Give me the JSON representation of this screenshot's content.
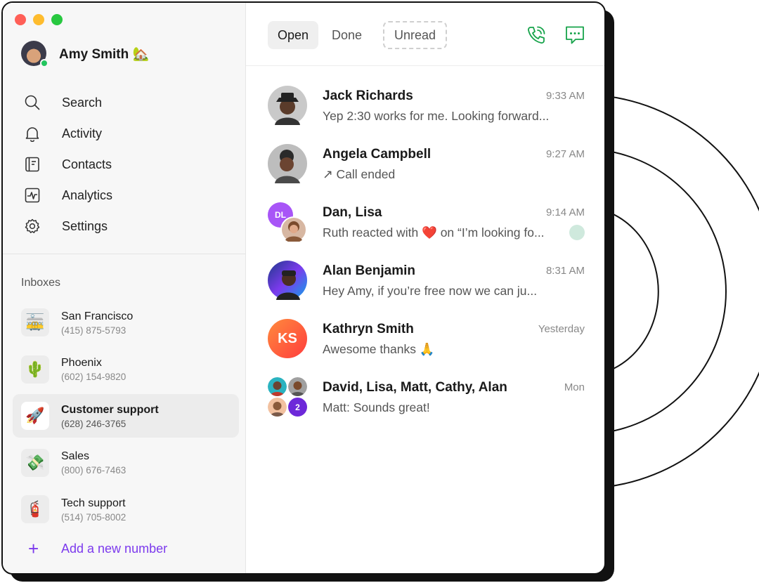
{
  "profile": {
    "name": "Amy Smith 🏡"
  },
  "nav": [
    {
      "label": "Search",
      "icon": "search-icon"
    },
    {
      "label": "Activity",
      "icon": "bell-icon"
    },
    {
      "label": "Contacts",
      "icon": "contacts-icon"
    },
    {
      "label": "Analytics",
      "icon": "analytics-icon"
    },
    {
      "label": "Settings",
      "icon": "gear-icon"
    }
  ],
  "inboxes": {
    "title": "Inboxes",
    "items": [
      {
        "emoji": "🚋",
        "name": "San Francisco",
        "phone": "(415) 875-5793"
      },
      {
        "emoji": "🌵",
        "name": "Phoenix",
        "phone": "(602) 154-9820"
      },
      {
        "emoji": "🚀",
        "name": "Customer support",
        "phone": "(628) 246-3765"
      },
      {
        "emoji": "💸",
        "name": "Sales",
        "phone": "(800) 676-7463"
      },
      {
        "emoji": "🧯",
        "name": "Tech support",
        "phone": "(514) 705-8002"
      }
    ],
    "add_label": "Add a new number"
  },
  "tabs": {
    "open": "Open",
    "done": "Done",
    "unread": "Unread"
  },
  "conversations": [
    {
      "name": "Jack Richards",
      "time": "9:33 AM",
      "preview": "Yep 2:30 works for me. Looking forward..."
    },
    {
      "name": "Angela Campbell",
      "time": "9:27 AM",
      "preview": "↗ Call ended"
    },
    {
      "name": "Dan, Lisa",
      "time": "9:14 AM",
      "preview": "Ruth reacted with ❤️ on “I’m looking fo...",
      "initials": "DL"
    },
    {
      "name": "Alan Benjamin",
      "time": "8:31 AM",
      "preview": "Hey Amy, if you’re free now we can ju..."
    },
    {
      "name": "Kathryn Smith",
      "time": "Yesterday",
      "preview": "Awesome thanks 🙏",
      "initials": "KS"
    },
    {
      "name": "David, Lisa, Matt, Cathy, Alan",
      "time": "Mon",
      "preview": "Matt: Sounds great!",
      "extra_count": "2"
    }
  ],
  "colors": {
    "accent": "#7c3aed",
    "green": "#16a34a",
    "online": "#22c55e"
  }
}
